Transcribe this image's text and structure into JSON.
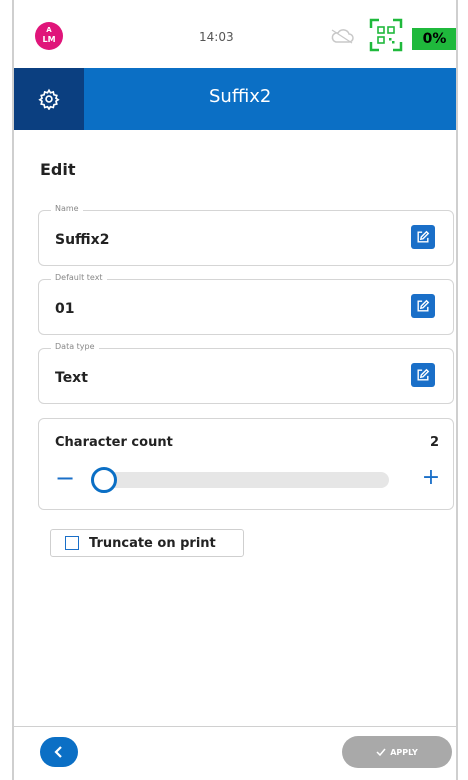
{
  "status_bar": {
    "avatar_line1": "A",
    "avatar_line2": "LM",
    "time": "14:03",
    "battery": "0%",
    "colors": {
      "avatar": "#e0157a",
      "battery": "#1fb93c"
    },
    "icons": [
      "cloud-icon",
      "qr-scan-icon"
    ]
  },
  "header": {
    "title": "Suffix2",
    "icon": "gear-icon",
    "colors": {
      "bar": "#0b6fc5",
      "icon_box": "#0b3f80"
    }
  },
  "page": {
    "section_title": "Edit"
  },
  "fields": [
    {
      "label": "Name",
      "value": "Suffix2"
    },
    {
      "label": "Default text",
      "value": "01"
    },
    {
      "label": "Data type",
      "value": "Text"
    }
  ],
  "character_count": {
    "label": "Character count",
    "value": "2",
    "minus": "−",
    "plus": "+",
    "slider_fraction": 0.0
  },
  "truncate": {
    "label": "Truncate on print",
    "checked": false
  },
  "footer": {
    "back_icon": "chevron-left-icon",
    "apply_label": "APPLY",
    "apply_icon": "check-icon"
  }
}
